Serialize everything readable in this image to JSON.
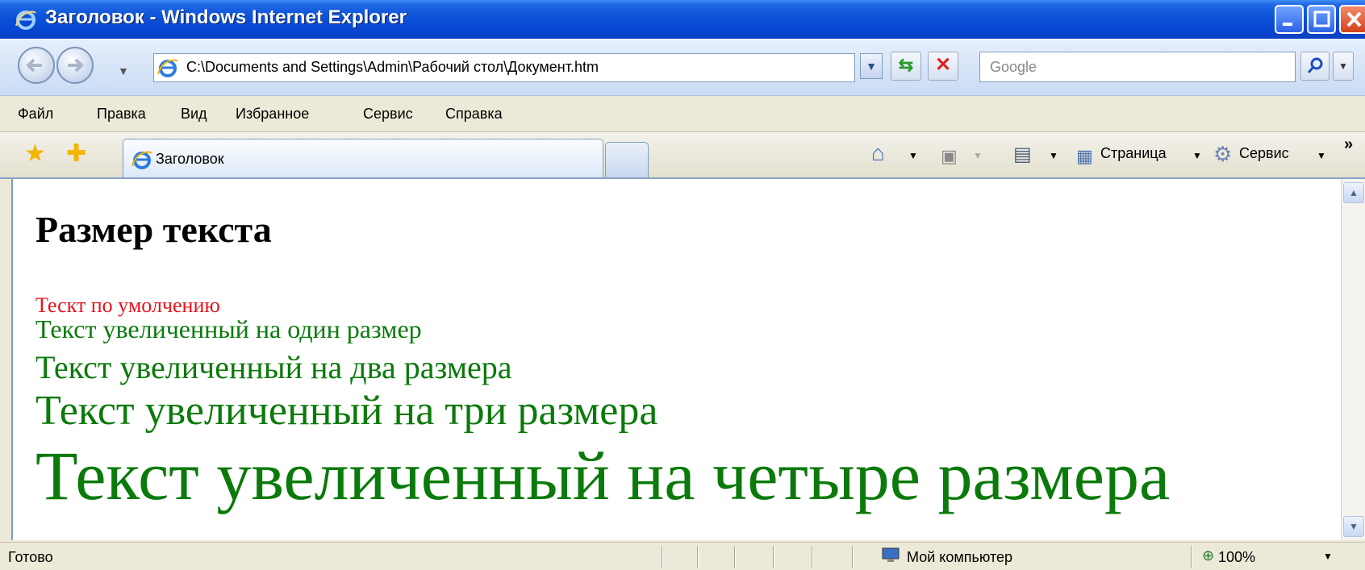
{
  "window": {
    "title": "Заголовок - Windows Internet Explorer"
  },
  "address_bar": {
    "url": "C:\\Documents and Settings\\Admin\\Рабочий стол\\Документ.htm",
    "search_placeholder": "Google"
  },
  "menu": {
    "items": [
      "Файл",
      "Правка",
      "Вид",
      "Избранное",
      "Сервис",
      "Справка"
    ]
  },
  "toolbar": {
    "tab_title": "Заголовок",
    "page_label": "Страница",
    "tools_label": "Сервис",
    "more": "»"
  },
  "content": {
    "heading": "Размер текста",
    "lines": [
      "Тескт по умолчению",
      "Текст увеличенный на один размер",
      "Текст увеличенный на два размера",
      "Текст увеличенный на три размера",
      "Текст увеличенный на четыре размера"
    ],
    "colors": {
      "default": "#e8141c",
      "enlarged": "#0a7a0a"
    }
  },
  "statusbar": {
    "status": "Готово",
    "zone": "Мой компьютер",
    "zoom": "100%"
  },
  "icons": {
    "title": "ie-logo-icon",
    "back": "back-arrow-icon",
    "forward": "forward-arrow-icon",
    "refresh": "refresh-icon",
    "stop": "stop-icon",
    "search": "search-icon",
    "favorites": "favorites-star-icon",
    "add_favorites": "add-favorites-icon",
    "home": "home-icon",
    "feeds": "feeds-icon",
    "print": "print-icon",
    "page": "page-icon",
    "tools": "gear-icon",
    "zone": "computer-icon",
    "zoom": "zoom-icon"
  }
}
